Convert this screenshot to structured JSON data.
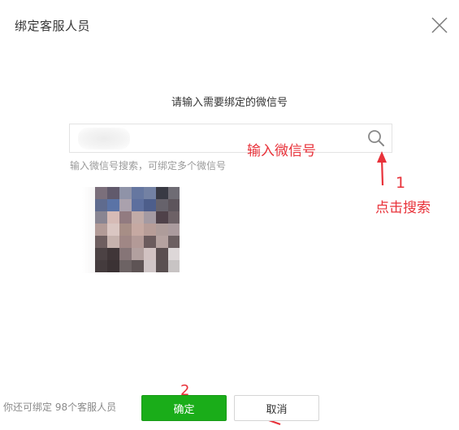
{
  "dialog": {
    "title": "绑定客服人员",
    "close_icon": "close-icon"
  },
  "search": {
    "prompt": "请输入需要绑定的微信号",
    "value": "",
    "placeholder": "",
    "button_icon": "search-icon",
    "hint": "输入微信号搜索，可绑定多个微信号"
  },
  "result": {
    "avatar_icon": "avatar",
    "mosaic_colors": [
      "#7b6f7b",
      "#615a6c",
      "#8f93a8",
      "#6677a0",
      "#7381a3",
      "#393a44",
      "#6f6c74",
      "#5f6b8e",
      "#5a73a6",
      "#aaa1ad",
      "#5d6f9e",
      "#4d5e8b",
      "#66626b",
      "#5d555c",
      "#898592",
      "#d6bbb6",
      "#927b80",
      "#c1aba7",
      "#a49aa2",
      "#4f4149",
      "#6d6166",
      "#b29b97",
      "#dac6c2",
      "#a78e86",
      "#c6a9a2",
      "#b79d98",
      "#ae9c9a",
      "#ab9b9e",
      "#6e5e5f",
      "#c6b2ad",
      "#a08785",
      "#b39a97",
      "#6b5b5d",
      "#b5a2a0",
      "#6c5f61",
      "#4c4244",
      "#403638",
      "#867577",
      "#b2a09f",
      "#d1c2c2",
      "#5a4e50",
      "#ddd7d8",
      "#443b3d",
      "#3b3234",
      "#6d6364",
      "#5e5455",
      "#cfc6c7",
      "#595051",
      "#c8c4c4"
    ]
  },
  "annotations": {
    "input_label": "输入微信号",
    "step1_number": "1",
    "step1_label": "点击搜索",
    "step2_number": "2",
    "color": "#e8323a"
  },
  "footer": {
    "remaining_text": "你还可绑定 98个客服人员",
    "confirm_label": "确定",
    "cancel_label": "取消"
  },
  "colors": {
    "primary": "#1aad19",
    "annotation": "#e8323a"
  }
}
